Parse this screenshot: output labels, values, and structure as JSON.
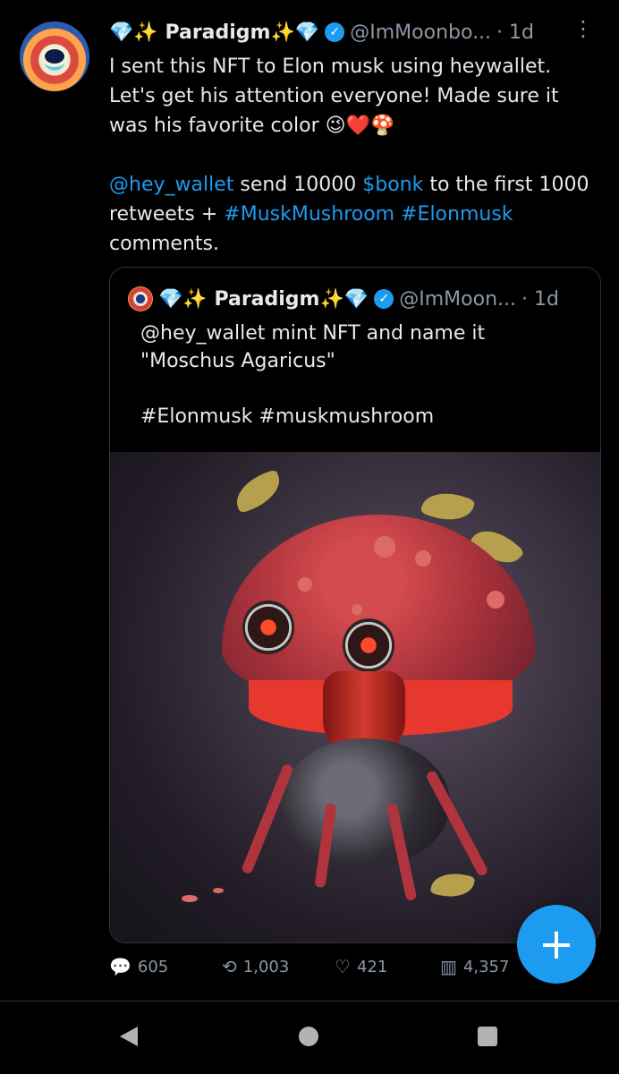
{
  "post": {
    "display_name": "💎✨ Paradigm✨💎",
    "handle": "@ImMoonbo...",
    "time": "· 1d",
    "menu_icon": "⋮",
    "text_line_1": "I sent this NFT to Elon musk using heywallet. Let's get his attention everyone! Made sure it was his favorite color 😉❤️🍄",
    "mention": "@hey_wallet",
    "text_middle_1": " send 10000 ",
    "cashtag": "$bonk",
    "text_middle_2": " to the first 1000 retweets + ",
    "hashtag_1": "#MuskMushroom",
    "space_1": " ",
    "hashtag_2": "#Elonmusk",
    "text_end": " comments."
  },
  "quote": {
    "display_name": "💎✨ Paradigm✨💎",
    "handle": "@ImMoon...",
    "time": "· 1d",
    "text_line_1": "@hey_wallet mint NFT and name it \"Moschus Agaricus\"",
    "text_line_2": "#Elonmusk #muskmushroom"
  },
  "actions": {
    "reply_count": "605",
    "retweet_count": "1,003",
    "like_count": "421",
    "view_count": "4,357"
  },
  "fab": {
    "label": "+"
  },
  "colors": {
    "background": "#000000",
    "text": "#e7e9ea",
    "secondary": "#8b98a5",
    "accent": "#1d9bf0"
  },
  "icons": {
    "reply": "💬",
    "retweet": "⟲",
    "like": "♡",
    "views": "▥"
  }
}
